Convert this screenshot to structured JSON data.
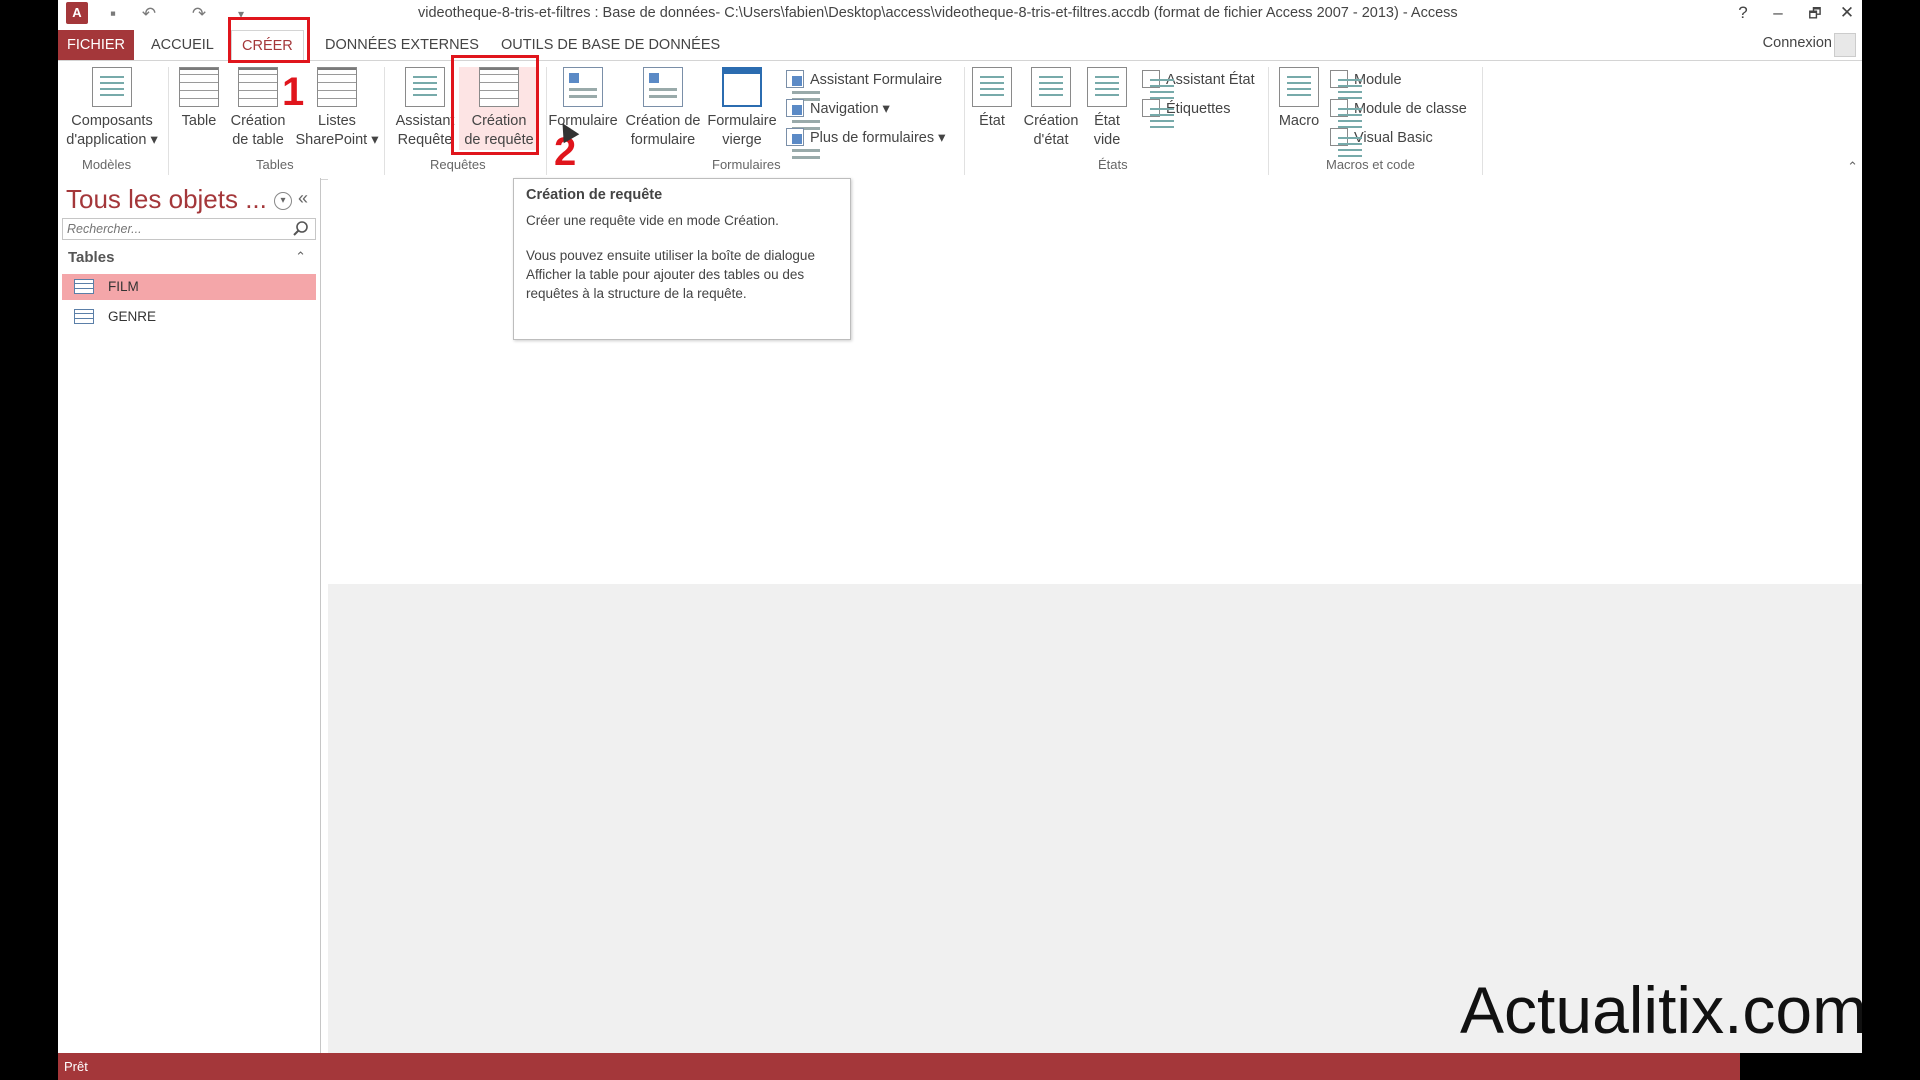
{
  "app": {
    "window_title": "videotheque-8-tris-et-filtres : Base de données- C:\\Users\\fabien\\Desktop\\access\\videotheque-8-tris-et-filtres.accdb (format de fichier Access 2007 - 2013) - Access",
    "icon_letter": "A",
    "connexion": "Connexion",
    "help": "?",
    "minimize": "–",
    "restore": "🗗",
    "close": "✕"
  },
  "tabs": [
    {
      "label": "FICHIER"
    },
    {
      "label": "ACCUEIL"
    },
    {
      "label": "CRÉER"
    },
    {
      "label": "DONNÉES EXTERNES"
    },
    {
      "label": "OUTILS DE BASE DE DONNÉES"
    }
  ],
  "steps": {
    "one": "1",
    "two": "2"
  },
  "ribbon": {
    "groups": {
      "modeles": "Modèles",
      "tables": "Tables",
      "requetes": "Requêtes",
      "formulaires": "Formulaires",
      "etats": "États",
      "macros": "Macros et code"
    },
    "buttons": {
      "composants_l1": "Composants",
      "composants_l2": "d'application ▾",
      "table": "Table",
      "creation_table_l1": "Création",
      "creation_table_l2": "de table",
      "listes_l1": "Listes",
      "listes_l2": "SharePoint ▾",
      "assistant_req_l1": "Assistant",
      "assistant_req_l2": "Requête",
      "creation_req_l1": "Création",
      "creation_req_l2": "de requête",
      "formulaire": "Formulaire",
      "creation_form_l1": "Création de",
      "creation_form_l2": "formulaire",
      "form_vierge_l1": "Formulaire",
      "form_vierge_l2": "vierge",
      "assistant_formulaire": "Assistant Formulaire",
      "navigation": "Navigation ▾",
      "plus_formulaires": "Plus de formulaires ▾",
      "etat": "État",
      "creation_etat_l1": "Création",
      "creation_etat_l2": "d'état",
      "etat_vide_l1": "État",
      "etat_vide_l2": "vide",
      "assistant_etat": "Assistant État",
      "etiquettes": "Étiquettes",
      "macro": "Macro",
      "module": "Module",
      "module_classe": "Module de classe",
      "visual_basic": "Visual Basic"
    },
    "collapse": "⌃"
  },
  "nav": {
    "title": "Tous les objets ...",
    "search_placeholder": "Rechercher...",
    "group": "Tables",
    "items": [
      {
        "label": "FILM"
      },
      {
        "label": "GENRE"
      }
    ]
  },
  "tooltip": {
    "title": "Création de requête",
    "line1": "Créer une requête vide en mode Création.",
    "line2": "Vous pouvez ensuite utiliser la boîte de dialogue Afficher la table pour ajouter des tables ou des requêtes à la structure de la requête."
  },
  "status": {
    "label": "Prêt"
  },
  "watermark": "Actualitix.com"
}
